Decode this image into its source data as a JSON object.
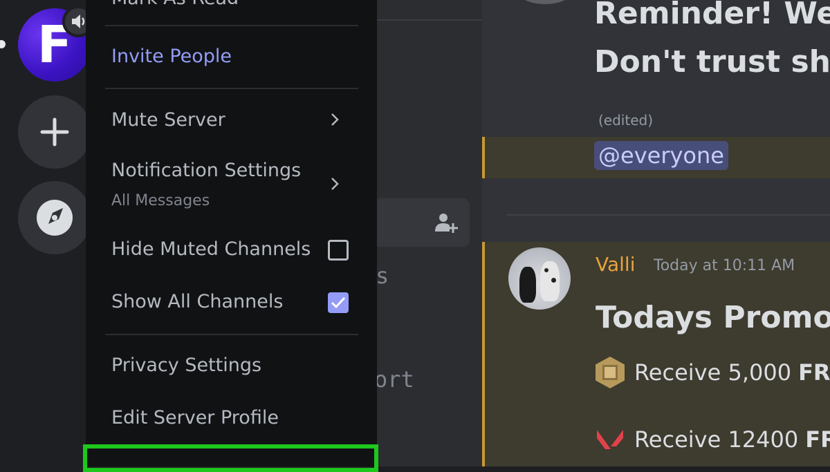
{
  "menu": {
    "mark_as_read": "Mark As Read",
    "invite_people": "Invite People",
    "mute_server": "Mute Server",
    "notification_settings": "Notification Settings",
    "notification_sub": "All Messages",
    "hide_muted_channels": "Hide Muted Channels",
    "hide_muted_checked": false,
    "show_all_channels": "Show All Channels",
    "show_all_checked": true,
    "privacy_settings": "Privacy Settings",
    "edit_server_profile": "Edit Server Profile"
  },
  "servers": {
    "active_initial": "F",
    "icons": [
      "speaker-icon",
      "plus-icon",
      "compass-icon"
    ]
  },
  "channels": {
    "partial_text_1": "s",
    "partial_text_2": "ort"
  },
  "chat": {
    "message1": {
      "title_line1": "Reminder! We",
      "title_line2": "Don't trust sho",
      "edited": "(edited)",
      "mention": "@everyone"
    },
    "message2": {
      "author": "Valli",
      "timestamp": "Today at 10:11 AM",
      "title": "Todays Promot",
      "line1_text": "Receive 5,000",
      "line1_bold": "FRE",
      "line2_text": "Receive 12400",
      "line2_bold": "FRE"
    }
  },
  "colors": {
    "accent": "#949cf7",
    "highlight": "#1dc71d",
    "author": "#e8a43a"
  }
}
